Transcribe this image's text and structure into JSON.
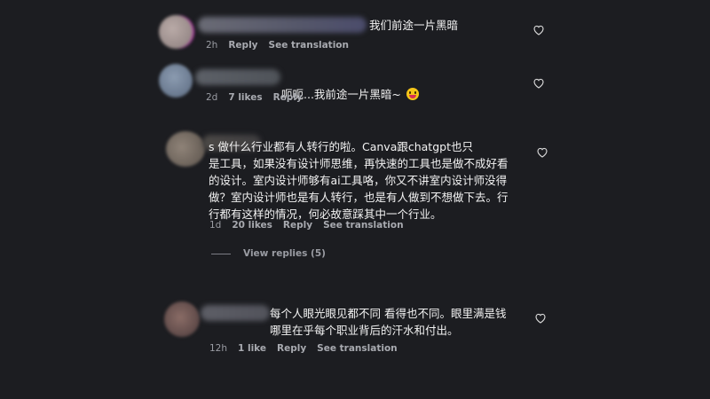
{
  "comments": [
    {
      "text": "我们前途一片黑暗",
      "meta": {
        "time": "2h",
        "likes": "",
        "reply": "Reply",
        "translate": "See translation"
      }
    },
    {
      "text": "呃呃...我前途一片黑暗~",
      "emoji": "grinning-face-with-tongue",
      "meta": {
        "time": "2d",
        "likes": "7 likes",
        "reply": "Reply",
        "translate": ""
      }
    },
    {
      "text": "s 做什么行业都有人转行的啦。Canva跟chatgpt也只\n是工具，如果没有设计师思维，再快速的工具也是做不成好看\n的设计。室内设计师够有ai工具咯，你又不讲室内设计师没得\n做？室内设计师也是有人转行，也是有人做到不想做下去。行\n行都有这样的情况，何必故意踩其中一个行业。",
      "meta": {
        "time": "1d",
        "likes": "20 likes",
        "reply": "Reply",
        "translate": "See translation"
      },
      "view_replies": "View replies (5)"
    },
    {
      "text": "每个人眼光眼见都不同 看得也不同。眼里满是钱\n哪里在乎每个职业背后的汗水和付出。",
      "meta": {
        "time": "12h",
        "likes": "1 like",
        "reply": "Reply",
        "translate": "See translation"
      }
    }
  ],
  "colors": {
    "background": "#1c1d21",
    "text": "#f3f3f3",
    "meta": "#9a9ca3"
  }
}
